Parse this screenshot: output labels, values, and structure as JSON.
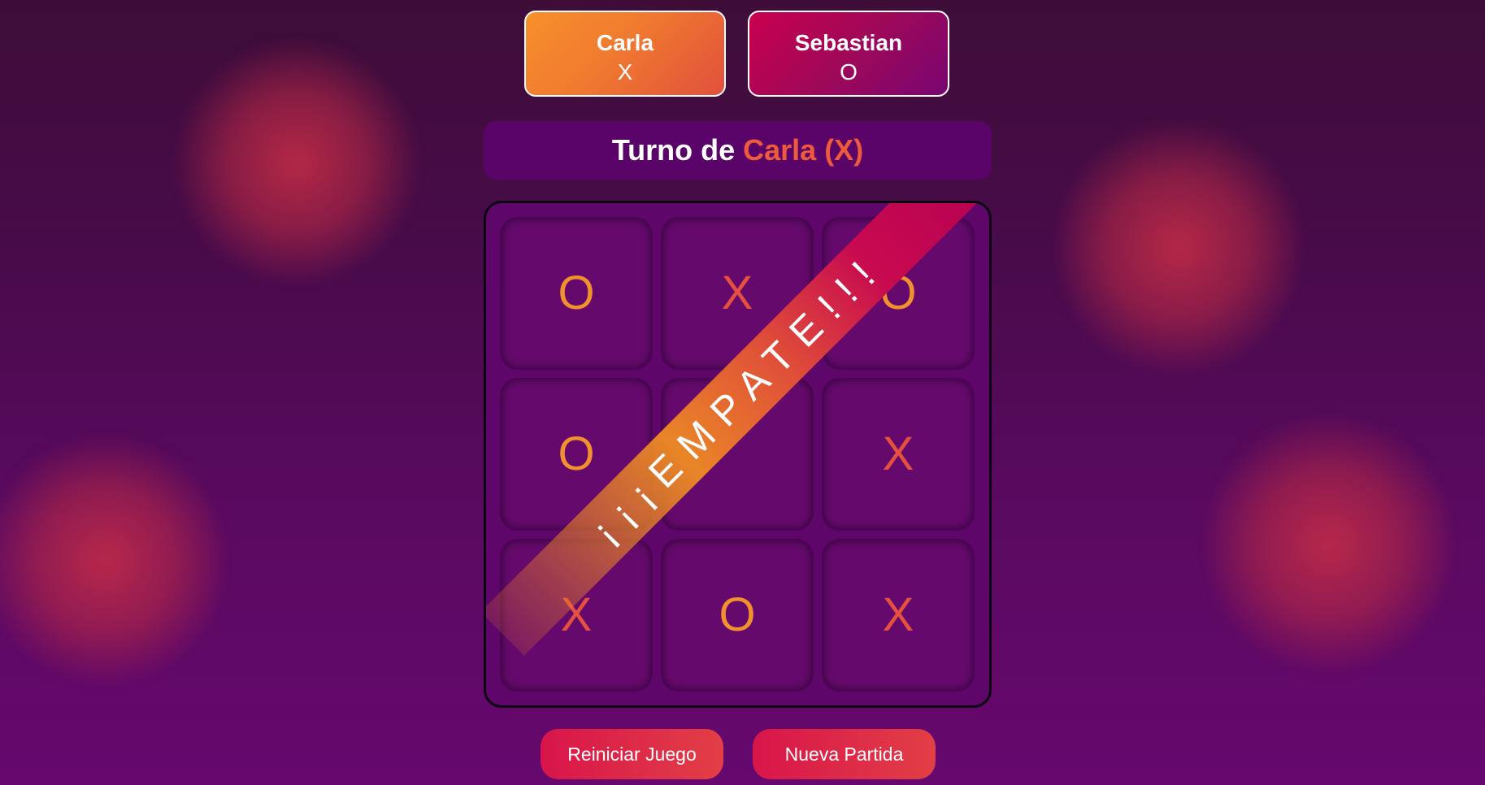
{
  "players": [
    {
      "name": "Carla",
      "symbol": "X"
    },
    {
      "name": "Sebastian",
      "symbol": "O"
    }
  ],
  "turn": {
    "prefix": "Turno de",
    "player": "Carla (X)"
  },
  "board": [
    [
      "O",
      "X",
      "O"
    ],
    [
      "O",
      "",
      "X"
    ],
    [
      "X",
      "O",
      "X"
    ]
  ],
  "result_banner": "¡¡¡EMPATE!!!",
  "buttons": {
    "reset": "Reiniciar Juego",
    "new_game": "Nueva Partida"
  },
  "colors": {
    "x_mark": "#e6503f",
    "o_mark": "#f0912e",
    "turn_highlight": "#ee5a3c",
    "background": "#4a0b4c"
  }
}
